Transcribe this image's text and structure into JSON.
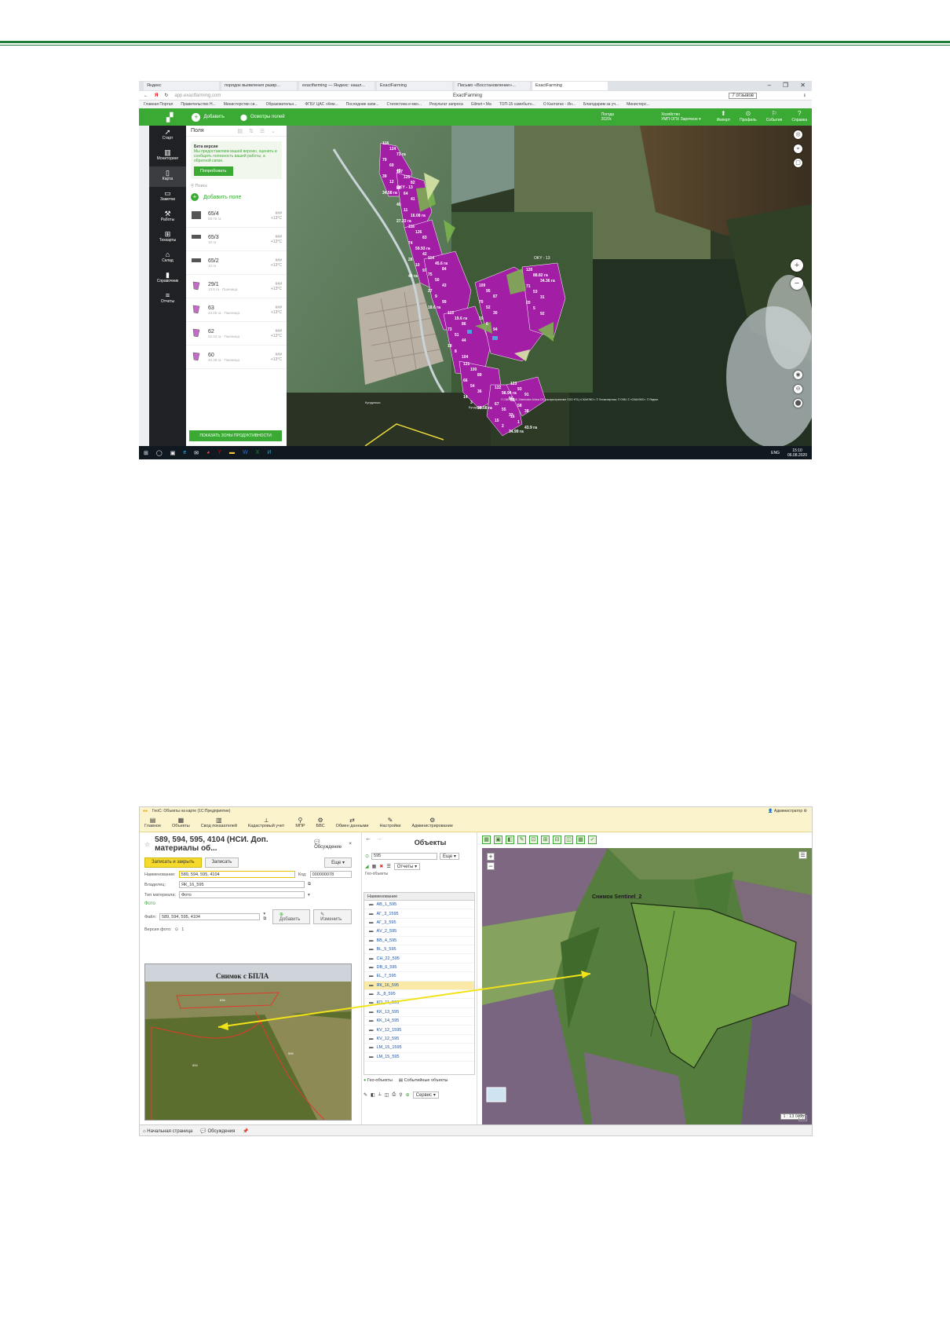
{
  "s1": {
    "tabs": [
      "Яндекс",
      "порядок выявления развр...",
      "exactfarming — Яндекс: нашл...",
      "ExactFarming",
      "Письмо «Восстановление»...",
      "ExactFarming"
    ],
    "page_title": "ExactFarming",
    "url": "app.exactfarming.com",
    "reviews": "7 отзывов",
    "bookmarks": [
      "Главная Портал",
      "Правительство Н...",
      "Министерство си...",
      "Образовательн...",
      "ФГБУ ЦАС «Кем...",
      "Последние запи...",
      "Статистика и мко...",
      "Результат запроса",
      "Gilmet • Ма",
      "ТОП-15 самобытн...",
      "О Кантатах - Ин...",
      "Благодарим за уч...",
      "Министерс..."
    ],
    "app": {
      "add_label": "Добавить",
      "inspect_label": "Осмотры полей",
      "weather_label": "Погода",
      "weather_value": "2020г.",
      "org_label": "Хозяйство",
      "org_value": "УМП ОПХ Заречное",
      "actions": [
        "Импорт",
        "Профиль",
        "События",
        "Справка"
      ]
    },
    "nav": [
      "Старт",
      "Мониторинг",
      "Карта",
      "Заметки",
      "Работы",
      "Техкарты",
      "Склад",
      "Справочник",
      "Отчеты"
    ],
    "panel": {
      "title": "Поля",
      "beta_title": "Бета версия",
      "beta_text": "Мы предоставляем вашей версию, оценить и сообщить полезность вашей работы, а обратной связи.",
      "try_button": "Попробовать",
      "search_placeholder": "Поиск",
      "add_field": "Добавить поле",
      "show_button": "ПОКАЗАТЬ ЗОНЫ ПРОДУКТИВНОСТИ"
    },
    "fields": [
      {
        "name": "65/4",
        "sub": "58.76 га",
        "r1": "###",
        "r2": "+13°C"
      },
      {
        "name": "65/3",
        "sub": "10 га",
        "r1": "###",
        "r2": "+13°C"
      },
      {
        "name": "65/2",
        "sub": "10 га",
        "r1": "###",
        "r2": "+13°C"
      },
      {
        "name": "29/1",
        "sub": "13.5 га · Пшеница",
        "r1": "###",
        "r2": "+13°C"
      },
      {
        "name": "63",
        "sub": "43.25 га · Пшеница",
        "r1": "###",
        "r2": "+13°C"
      },
      {
        "name": "62",
        "sub": "32.23 га · Пшеница",
        "r1": "###",
        "r2": "+13°C"
      },
      {
        "name": "60",
        "sub": "40.28 га · Пшеница",
        "r1": "###",
        "r2": "+13°C"
      }
    ],
    "map_labels": [
      "118",
      "117",
      "116",
      "114",
      "113",
      "109",
      "120",
      "121",
      "122",
      "123",
      "124",
      "125",
      "126",
      "45.6 га",
      "19.6 га",
      "95",
      "88.82 га",
      "100",
      "98.94 га",
      "93",
      "73 га",
      "82",
      "83",
      "84",
      "86",
      "87",
      "34.36 га",
      "89",
      "90",
      "91",
      "79",
      "86",
      "74",
      "75",
      "73",
      "70",
      "71",
      "66",
      "67",
      "68",
      "69",
      "64",
      "59.93 га",
      "50",
      "51",
      "52",
      "53",
      "54",
      "55",
      "58",
      "45",
      "41",
      "42",
      "43",
      "44",
      "30",
      "31",
      "36",
      "37",
      "38",
      "39",
      "40",
      "28",
      "27",
      "18",
      "19",
      "20",
      "14",
      "15",
      "16",
      "12",
      "11",
      "10",
      "9",
      "8",
      "6",
      "5",
      "3",
      "2",
      "1",
      "OKY - 13",
      "16.08 га",
      "97",
      "99",
      "104",
      "94",
      "92",
      "28.08 га",
      "34.99 га",
      "43.9 га",
      "34.58 га",
      "27.22 га",
      "49 га",
      "18.6 га"
    ],
    "copyright": "© CNES 2018, Distribution Airbus DS, распространение ООО НТЦ «СКАНЭКС», © Геоэкспертиза, © OSM, © «СКАНЭКС», © Яндекс",
    "place1": "Кундрюши",
    "place2": "Кундроль",
    "tray_lang": "ENG",
    "tray_time": "15:10",
    "tray_date": "06.08.2020"
  },
  "s2": {
    "app_title": "ГеоС: Объекты на карте (1С:Предприятие)",
    "user": "Администратор",
    "menu": [
      "Главное",
      "Объекты",
      "Свод показателей",
      "Кадастровый учет",
      "МПР",
      "БВС",
      "Обмен данными",
      "Настройки",
      "Администрирование"
    ],
    "doc_title": "589, 594, 595, 4104 (НСИ. Доп. материалы об...",
    "discussion": "Обсуждение",
    "save_close": "Записать и закрыть",
    "save": "Записать",
    "more": "Еще",
    "name_label": "Наименование:",
    "name_value": "589, 594, 595, 4104",
    "code_label": "Код:",
    "code_value": "000000078",
    "owner_label": "Владелец:",
    "owner_value": "ЯК_16_595",
    "type_label": "Тип материала:",
    "type_value": "Фото",
    "photo_section": "Фото",
    "file_label": "Файл:",
    "file_value": "589, 594, 595, 4104",
    "add_btn": "Добавить",
    "change_btn": "Изменить",
    "version_label": "Версия фото:",
    "version_value": "1",
    "photo_caption": "Снимок с БПЛА",
    "photo_label2": "636",
    "photo_label3": "595",
    "photo_label4": "594",
    "objects_title": "Объекты",
    "search_value": "595",
    "reports": "Отчеты",
    "geo_label": "Гео-объекты",
    "col_header": "Наименование",
    "rows": [
      "АВ_1_595",
      "АГ_3_1595",
      "АГ_3_595",
      "АV_2_595",
      "ВВ_4_595",
      "ВL_5_595",
      "СН_22_595",
      "DB_6_595",
      "EL_7_595",
      "ЯК_16_595",
      "JL_8_595",
      "KD_11_595",
      "KK_13_595",
      "KK_14_595",
      "KV_12_1595",
      "KV_12_595",
      "LM_15_1595",
      "LM_15_595"
    ],
    "selected_index": 9,
    "tab_geo": "Гео-объекты",
    "tab_events": "Событийные объекты",
    "service": "Сервис",
    "map_caption": "Снимок Sentinel_2",
    "scale": "1 : 13 042",
    "help": "?",
    "bottom_tabs": [
      "Начальная страница",
      "Обсуждения"
    ],
    "yellow": "#f5d92b"
  }
}
